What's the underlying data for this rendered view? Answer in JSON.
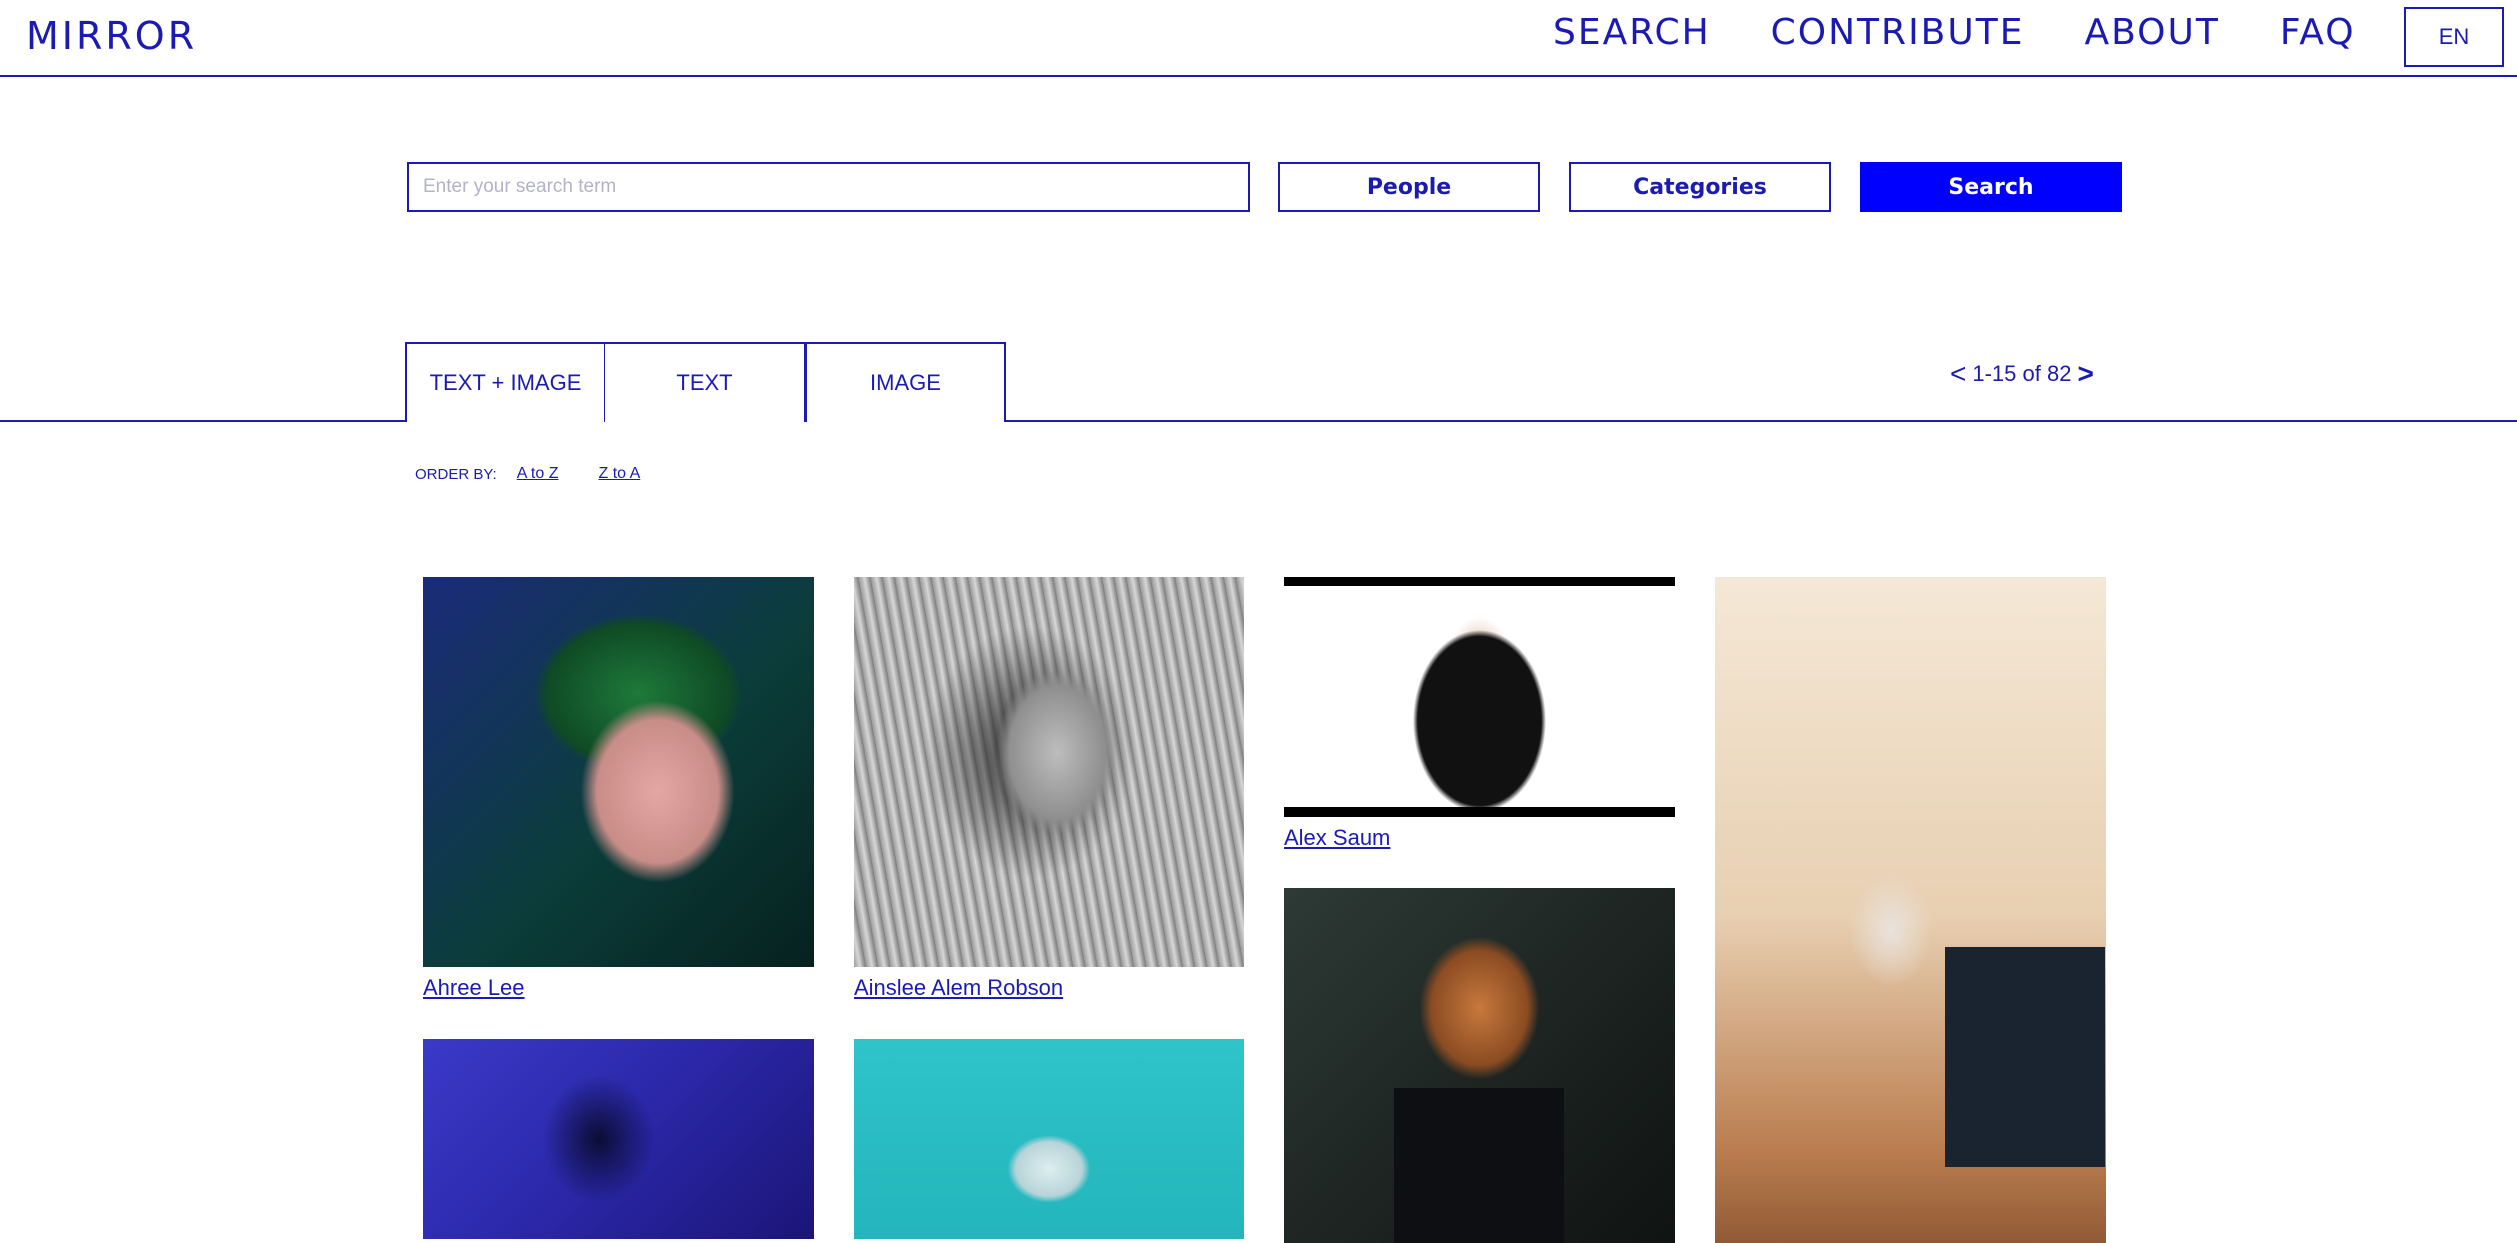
{
  "header": {
    "logo": "MIRROR",
    "nav": [
      "SEARCH",
      "CONTRIBUTE",
      "ABOUT",
      "FAQ"
    ],
    "lang": "EN"
  },
  "search": {
    "placeholder": "Enter your search term",
    "value": "",
    "people_label": "People",
    "categories_label": "Categories",
    "search_label": "Search"
  },
  "tabs": [
    "TEXT + IMAGE",
    "TEXT",
    "IMAGE"
  ],
  "active_tab": "IMAGE",
  "pager": {
    "prev": "<",
    "range": "1-15 of 82",
    "next": ">"
  },
  "order_by": {
    "label": "ORDER BY:",
    "options": [
      "A to Z",
      "Z to A"
    ]
  },
  "results": [
    {
      "name": "Ahree Lee"
    },
    {
      "name": "Ainslee Alem Robson"
    },
    {
      "name": "Alex Saum"
    },
    {
      "name": ""
    },
    {
      "name": ""
    },
    {
      "name": ""
    },
    {
      "name": ""
    }
  ],
  "colors": {
    "brand": "#1b1bb3",
    "search_button": "#0000ff"
  }
}
